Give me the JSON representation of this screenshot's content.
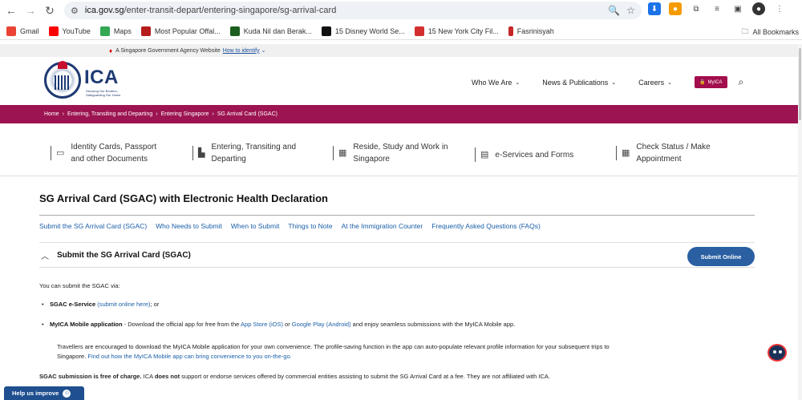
{
  "browser": {
    "url_domain": "ica.gov.sg",
    "url_path": "/enter-transit-depart/entering-singapore/sg-arrival-card"
  },
  "bookmarks": [
    {
      "label": "Gmail",
      "color": "#ea4335"
    },
    {
      "label": "YouTube",
      "color": "#ff0000"
    },
    {
      "label": "Maps",
      "color": "#34a853"
    },
    {
      "label": "Most Popular Offal...",
      "color": "#b71c1c"
    },
    {
      "label": "Kuda Nil dan Berak...",
      "color": "#1b5e20"
    },
    {
      "label": "15 Disney World Se...",
      "color": "#111111"
    },
    {
      "label": "15 New York City Fil...",
      "color": "#d32f2f"
    },
    {
      "label": "Fasrinisyah",
      "color": "#c62828"
    }
  ],
  "bookmarks_all": "All Bookmarks",
  "gov_banner": {
    "text": "A Singapore Government Agency Website",
    "link": "How to identify"
  },
  "logo": {
    "word": "ICA",
    "tagline": "Securing Our Borders, Safeguarding Our Home"
  },
  "nav": {
    "who": "Who We Are",
    "news": "News & Publications",
    "careers": "Careers",
    "myica": "MyICA"
  },
  "breadcrumb": {
    "home": "Home",
    "l1": "Entering, Transiting and Departing",
    "l2": "Entering Singapore",
    "l3": "SG Arrival Card (SGAC)"
  },
  "categories": {
    "c1a": "Identity Cards, Passport",
    "c1b": "and other Documents",
    "c2a": "Entering, Transiting and",
    "c2b": "Departing",
    "c3a": "Reside, Study and Work in",
    "c3b": "Singapore",
    "c4": "e-Services and Forms",
    "c5a": "Check Status / Make",
    "c5b": "Appointment"
  },
  "page_title": "SG Arrival Card (SGAC) with Electronic Health Declaration",
  "anchors": [
    "Submit the SG Arrival Card (SGAC)",
    "Who Needs to Submit",
    "When to Submit",
    "Things to Note",
    "At the Immigration Counter",
    "Frequently Asked Questions (FAQs)"
  ],
  "accordion": {
    "title": "Submit the SG Arrival Card (SGAC)",
    "button": "Submit Online"
  },
  "body": {
    "intro": "You can submit the SGAC via:",
    "b1_bold": "SGAC e-Service",
    "b1_link": "(submit online here)",
    "b1_rest": "; or",
    "b2_bold": "MyICA Mobile application",
    "b2_text": " - Download the official app for free from the ",
    "b2_link1": "App Store (iOS)",
    "b2_or": " or ",
    "b2_link2": "Google Play (Android)",
    "b2_end": " and enjoy seamless submissions with the MyICA Mobile app.",
    "para1": "Travellers are encouraged to download the MyICA Mobile application for your own convenience. The profile-saving function in the app can auto-populate relevant profile information for your subsequent trips to",
    "para2a": "Singapore. ",
    "para2_link": "Find out how the MyICA Mobile app can bring convenience to you on-the-go.",
    "free_bold": "SGAC submission is free of charge.",
    "free_mid": " ICA ",
    "free_bold2": "does not",
    "free_rest": " support or endorse services offered by commercial entities assisting to submit the SG Arrival Card at a fee. They are not affiliated with ICA."
  },
  "help": "Help us improve"
}
